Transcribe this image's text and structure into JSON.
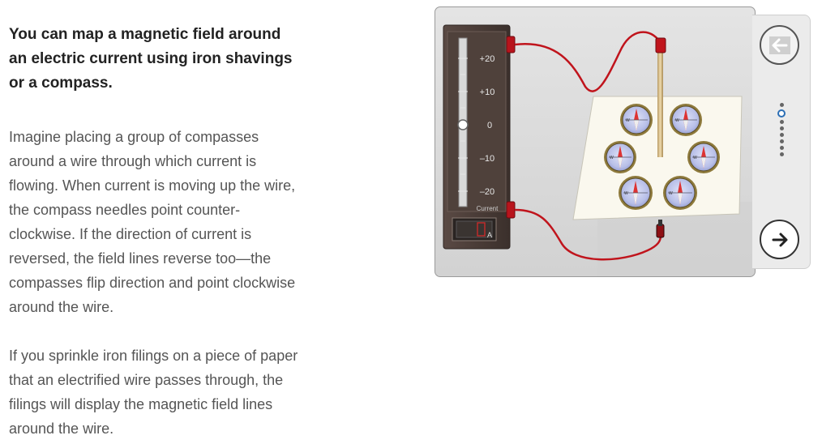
{
  "content": {
    "heading": "You can map a magnetic field around an electric current using iron shavings or a compass.",
    "paragraph1": "Imagine placing a group of compasses around a wire through which current is flowing. When current is moving up the wire, the compass needles point counter-clockwise. If the direction of current is reversed, the field lines reverse too—the compasses flip direction and point clockwise around the wire.",
    "paragraph2": "If you sprinkle iron filings on a piece of paper that an electrified wire passes through, the filings will display the magnetic field lines around the wire."
  },
  "simulation": {
    "scale_labels": [
      "+20",
      "+10",
      "0",
      "–10",
      "–20"
    ],
    "scale_title": "Current",
    "current_value": 0,
    "unit": "A",
    "compass_letter": "W"
  },
  "navigation": {
    "prev_icon": "arrow-left-icon",
    "next_icon": "arrow-right-icon",
    "dot_count": 8,
    "active_dot": 1
  },
  "colors": {
    "wire": "#c0141c",
    "accent": "#2c6fb5"
  }
}
